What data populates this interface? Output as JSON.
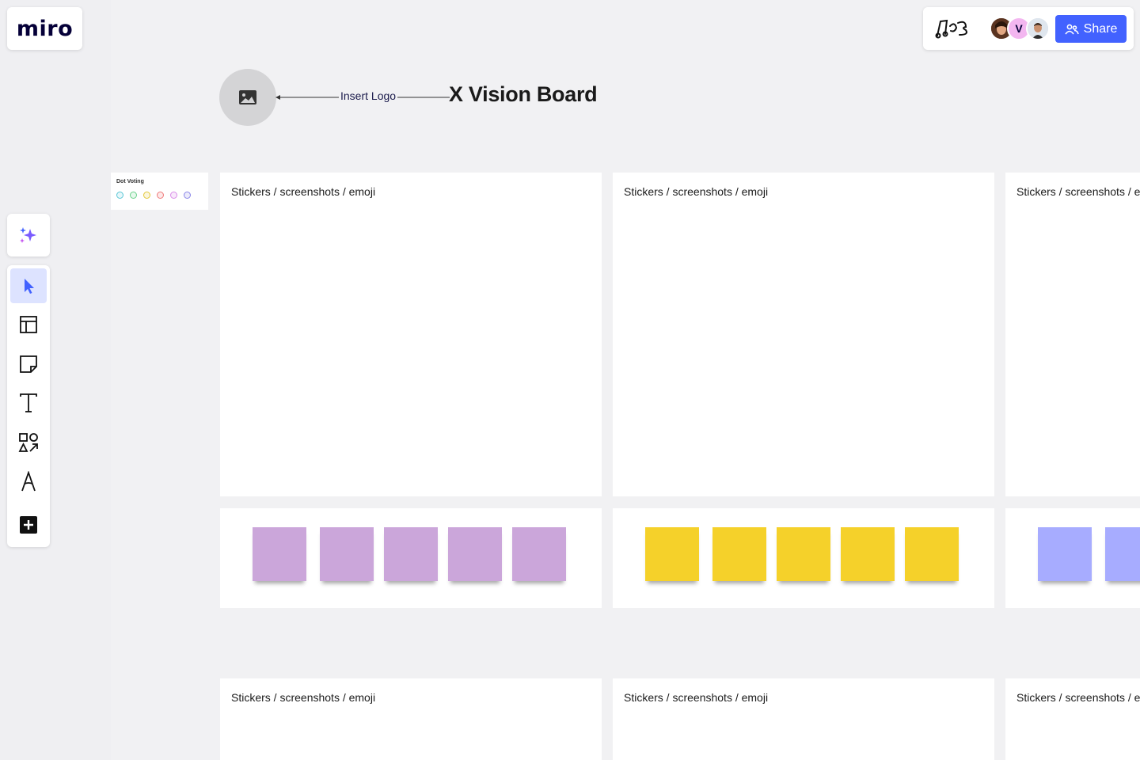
{
  "app": {
    "logo_text": "miro"
  },
  "collaboration": {
    "avatars": [
      {
        "name": "collaborator-avatar-1",
        "initial": ""
      },
      {
        "name": "collaborator-avatar-2",
        "initial": "V"
      },
      {
        "name": "collaborator-avatar-3",
        "initial": ""
      }
    ],
    "share_label": "Share",
    "share_color": "#4262ff"
  },
  "toolbar": {
    "tools": [
      {
        "name": "select-tool",
        "icon": "cursor-icon"
      },
      {
        "name": "templates-tool",
        "icon": "layout-icon"
      },
      {
        "name": "sticky-note-tool",
        "icon": "sticky-note-icon"
      },
      {
        "name": "text-tool",
        "icon": "text-icon"
      },
      {
        "name": "shapes-tool",
        "icon": "shapes-icon"
      },
      {
        "name": "pen-tool",
        "icon": "pen-icon"
      },
      {
        "name": "more-apps-tool",
        "icon": "plus-box-icon"
      }
    ],
    "active": "select-tool"
  },
  "board": {
    "insert_logo_label": "Insert Logo",
    "title": "X Vision Board",
    "dot_voting": {
      "title": "Dot Voting",
      "dot_colors": [
        "#5bc7d6",
        "#6bd18a",
        "#e3c83a",
        "#ef7a7a",
        "#d98ce8",
        "#8a86e8"
      ]
    },
    "frame_label": "Stickers / screenshots / emoji",
    "sticky_colors": {
      "purple": "#cba6da",
      "yellow": "#f5d12a",
      "blue": "#a7acff"
    },
    "frames": [
      {
        "label": "Stickers / screenshots / emoji"
      },
      {
        "label": "Stickers / screenshots / emoji"
      },
      {
        "label": "Stickers / screenshots / emoji"
      },
      {
        "label": "Stickers / screenshots / emoji"
      },
      {
        "label": "Stickers / screenshots / emoji"
      },
      {
        "label": "Stickers / screenshots / emoji"
      }
    ]
  }
}
